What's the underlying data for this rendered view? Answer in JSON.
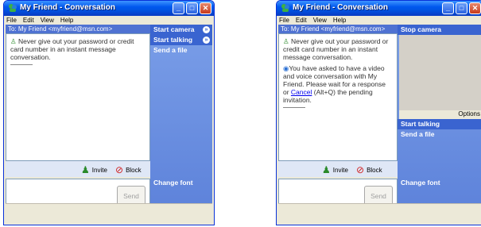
{
  "window1": {
    "title": "My Friend - Conversation",
    "menu": [
      "File",
      "Edit",
      "View",
      "Help"
    ],
    "to_line": "To: My Friend <myfriend@msn.com>",
    "warning": "Never give out your password or credit card number in an instant message conversation.",
    "tasks": [
      "Start camera",
      "Start talking",
      "Send a file"
    ],
    "invite_label": "Invite",
    "block_label": "Block",
    "send_label": "Send",
    "change_font": "Change font"
  },
  "window2": {
    "title": "My Friend - Conversation",
    "menu": [
      "File",
      "Edit",
      "View",
      "Help"
    ],
    "to_line": "To: My Friend <myfriend@msn.com>",
    "warning": "Never give out your password or credit card number in an instant message conversation.",
    "invite_msg_before": "You have asked to have a video and voice conversation with My Friend. Please wait for a response or ",
    "cancel_link": "Cancel",
    "invite_msg_after": " (Alt+Q) the pending invitation.",
    "tasks_top": [
      "Stop camera"
    ],
    "options_label": "Options",
    "tasks_bottom": [
      "Start talking",
      "Send a file"
    ],
    "invite_label": "Invite",
    "block_label": "Block",
    "send_label": "Send",
    "change_font": "Change font"
  }
}
